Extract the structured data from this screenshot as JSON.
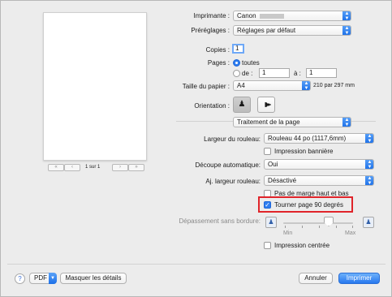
{
  "preview": {
    "page_indicator": "1 sur 1"
  },
  "printer": {
    "label": "Imprimante :",
    "value": "Canon"
  },
  "presets": {
    "label": "Préréglages :",
    "value": "Réglages par défaut"
  },
  "copies": {
    "label": "Copies :",
    "value": "1"
  },
  "pages": {
    "label": "Pages :",
    "all_label": "toutes",
    "from_label": "de :",
    "from_value": "1",
    "to_label": "à :",
    "to_value": "1"
  },
  "paper_size": {
    "label": "Taille du papier :",
    "value": "A4",
    "dimensions": "210 par 297 mm"
  },
  "orientation": {
    "label": "Orientation :"
  },
  "panel": {
    "value": "Traitement de la page"
  },
  "roll_width": {
    "label": "Largeur du rouleau:",
    "value": "Rouleau 44 po (1117,6mm)"
  },
  "banner": {
    "label": "Impression bannière",
    "checked": false
  },
  "auto_cut": {
    "label": "Découpe automatique:",
    "value": "Oui"
  },
  "fit_roll": {
    "label": "Aj. largeur rouleau:",
    "value": "Désactivé"
  },
  "no_margin": {
    "label": "Pas de marge haut et bas",
    "checked": false
  },
  "rotate": {
    "label": "Tourner page 90 degrés",
    "checked": true
  },
  "overflow": {
    "label": "Dépassement sans bordure:",
    "min_label": "Min",
    "max_label": "Max"
  },
  "centered": {
    "label": "Impression centrée",
    "checked": false
  },
  "footer": {
    "help": "?",
    "pdf_label": "PDF",
    "details_label": "Masquer les détails",
    "cancel_label": "Annuler",
    "print_label": "Imprimer"
  },
  "colors": {
    "accent": "#2f7ef0",
    "highlight": "#e0242a"
  }
}
